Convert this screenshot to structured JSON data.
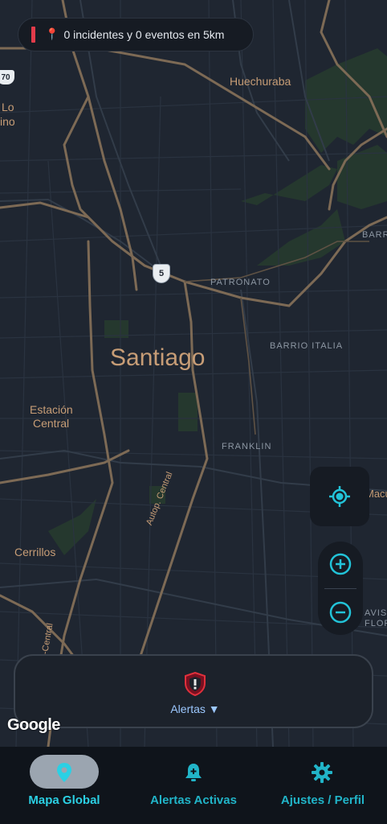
{
  "status": {
    "text": "0 incidentes y 0 eventos en 5km",
    "pin_icon": "map-pin-icon",
    "accent": "#e23b4a"
  },
  "map": {
    "city": "Santiago",
    "places": [
      "Huechuraba",
      "Estación",
      "Central",
      "Cerrillos",
      "Lo",
      "ino"
    ],
    "districts": [
      "PATRONATO",
      "BARRIO ITALIA",
      "FRANKLIN",
      "BARR",
      "Macu",
      "AVIS",
      "FLOR"
    ],
    "roads": [
      "Autop. Central",
      "-Central"
    ],
    "route_shields": [
      "5",
      "70"
    ]
  },
  "controls": {
    "locate_icon": "gps-locate-icon",
    "zoom_in_icon": "zoom-in-icon",
    "zoom_out_icon": "zoom-out-icon",
    "accent": "#22c3d8"
  },
  "alerts_card": {
    "label": "Alertas ▼",
    "icon": "shield-alert-icon"
  },
  "attribution": "Google",
  "nav": {
    "items": [
      {
        "label": "Mapa Global",
        "icon": "location-pin-icon",
        "active": true
      },
      {
        "label": "Alertas Activas",
        "icon": "bell-plus-icon",
        "active": false
      },
      {
        "label": "Ajustes / Perfil",
        "icon": "gear-icon",
        "active": false
      }
    ]
  }
}
